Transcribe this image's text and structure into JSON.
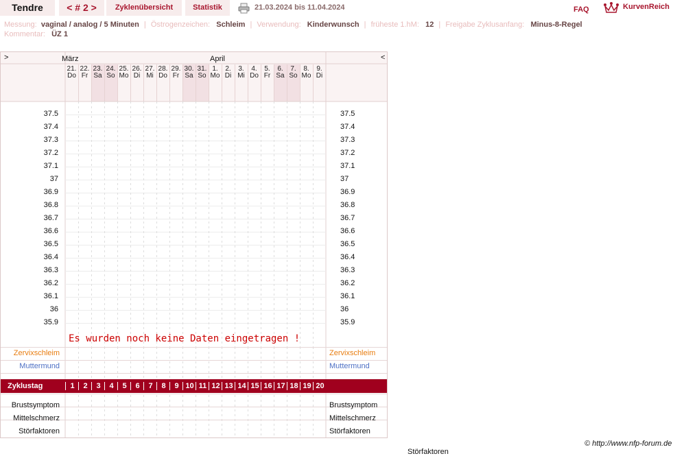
{
  "header": {
    "user": "Tendre",
    "cycle_nav": "< # 2 >",
    "tab_overview": "Zyklenübersicht",
    "tab_stats": "Statistik",
    "date_range": "21.03.2024 bis 11.04.2024",
    "faq": "FAQ",
    "logo_text": "KurvenReich",
    "icons": {
      "print": "printer-icon",
      "logo": "crown-logo-icon"
    }
  },
  "info": {
    "measurement_label": "Messung:",
    "measurement_value": "vaginal / analog / 5 Minuten",
    "estrogen_label": "Östrogenzeichen:",
    "estrogen_value": "Schleim",
    "usage_label": "Verwendung:",
    "usage_value": "Kinderwunsch",
    "earliest_label": "früheste 1.hM:",
    "earliest_value": "12",
    "release_label": "Freigabe Zyklusanfang:",
    "release_value": "Minus-8-Regel",
    "comment_label": "Kommentar:",
    "comment_value": "ÜZ 1"
  },
  "chart": {
    "nav_prev": ">",
    "nav_next": "<",
    "months": [
      "März",
      "April"
    ],
    "days": [
      {
        "date": "21.",
        "weekday": "Do",
        "weekend": false
      },
      {
        "date": "22.",
        "weekday": "Fr",
        "weekend": false
      },
      {
        "date": "23.",
        "weekday": "Sa",
        "weekend": true
      },
      {
        "date": "24.",
        "weekday": "So",
        "weekend": true
      },
      {
        "date": "25.",
        "weekday": "Mo",
        "weekend": false
      },
      {
        "date": "26.",
        "weekday": "Di",
        "weekend": false
      },
      {
        "date": "27.",
        "weekday": "Mi",
        "weekend": false
      },
      {
        "date": "28.",
        "weekday": "Do",
        "weekend": false
      },
      {
        "date": "29.",
        "weekday": "Fr",
        "weekend": false
      },
      {
        "date": "30.",
        "weekday": "Sa",
        "weekend": true
      },
      {
        "date": "31.",
        "weekday": "So",
        "weekend": true
      },
      {
        "date": "1.",
        "weekday": "Mo",
        "weekend": false
      },
      {
        "date": "2.",
        "weekday": "Di",
        "weekend": false
      },
      {
        "date": "3.",
        "weekday": "Mi",
        "weekend": false
      },
      {
        "date": "4.",
        "weekday": "Do",
        "weekend": false
      },
      {
        "date": "5.",
        "weekday": "Fr",
        "weekend": false
      },
      {
        "date": "6.",
        "weekday": "Sa",
        "weekend": true
      },
      {
        "date": "7.",
        "weekday": "So",
        "weekend": true
      },
      {
        "date": "8.",
        "weekday": "Mo",
        "weekend": false
      },
      {
        "date": "9.",
        "weekday": "Di",
        "weekend": false
      }
    ],
    "temperatures": [
      "37.5",
      "37.4",
      "37.3",
      "37.2",
      "37.1",
      "37",
      "36.9",
      "36.8",
      "36.7",
      "36.6",
      "36.5",
      "36.4",
      "36.3",
      "36.2",
      "36.1",
      "36",
      "35.9"
    ],
    "no_data_message": "Es wurden noch keine Daten eingetragen !",
    "rows_top": [
      "Zervixschleim",
      "Muttermund"
    ],
    "cycle_label": "Zyklustag",
    "cycle_days": [
      "1",
      "2",
      "3",
      "4",
      "5",
      "6",
      "7",
      "8",
      "9",
      "10",
      "11",
      "12",
      "13",
      "14",
      "15",
      "16",
      "17",
      "18",
      "19",
      "20"
    ],
    "rows_bottom": [
      "Brustsymptom",
      "Mittelschmerz",
      "Störfaktoren"
    ],
    "colors": {
      "accent": "#a0001e",
      "weekend": "#f2e0e3",
      "orange": "#e87d10",
      "blue": "#4d6fc4"
    }
  },
  "footer": {
    "copyright": "© http://www.nfp-forum.de",
    "cut_label": "Störfaktoren"
  }
}
